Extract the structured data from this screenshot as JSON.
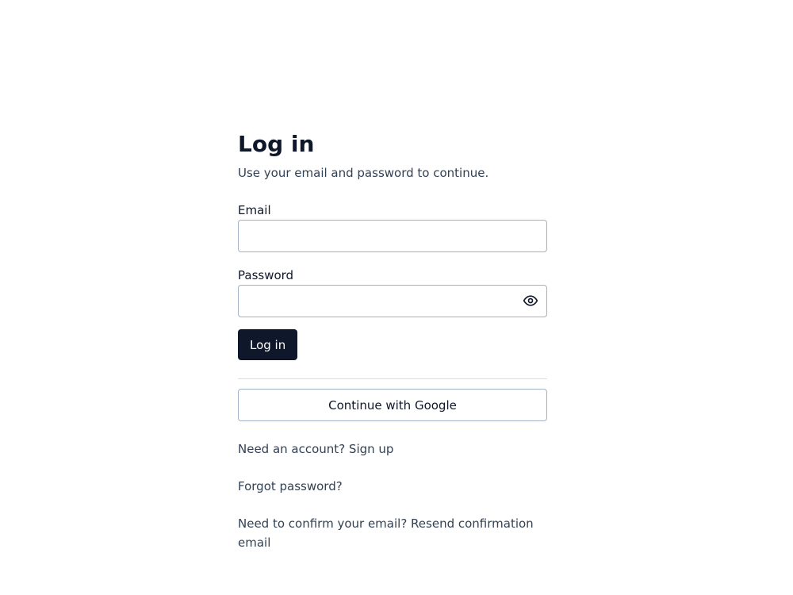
{
  "form": {
    "title": "Log in",
    "subtitle": "Use your email and password to continue.",
    "email": {
      "label": "Email",
      "value": "",
      "placeholder": ""
    },
    "password": {
      "label": "Password",
      "value": "",
      "placeholder": "",
      "toggle_icon": "eye-icon"
    },
    "submit_label": "Log in",
    "google_label": "Continue with Google",
    "links": {
      "signup": "Need an account? Sign up",
      "forgot": "Forgot password?",
      "resend": "Need to confirm your email? Resend confirmation email"
    }
  },
  "colors": {
    "primary": "#0f172a",
    "border": "#a3b1c6",
    "muted_text": "#334155",
    "divider": "#d9dee6"
  }
}
